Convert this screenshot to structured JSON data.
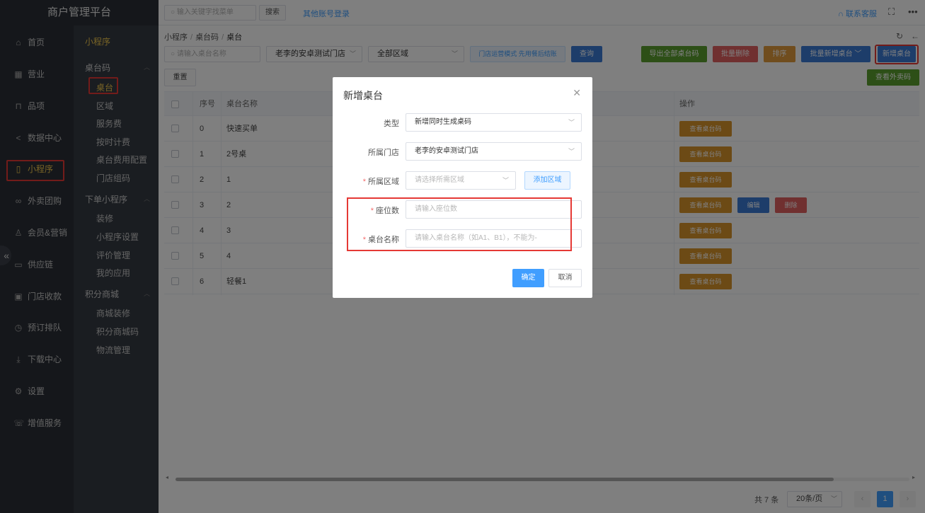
{
  "topbar": {
    "brand": "商户管理平台",
    "search_placeholder": "输入关键字找菜单",
    "search_button": "搜索",
    "other_login": "其他账号登录",
    "contact": "联系客服"
  },
  "sidebar": {
    "items": [
      {
        "icon": "home-icon",
        "label": "首页"
      },
      {
        "icon": "calendar-icon",
        "label": "营业"
      },
      {
        "icon": "bag-icon",
        "label": "品项"
      },
      {
        "icon": "share-icon",
        "label": "数据中心"
      },
      {
        "icon": "phone-icon",
        "label": "小程序"
      },
      {
        "icon": "bike-icon",
        "label": "外卖团购"
      },
      {
        "icon": "user-icon",
        "label": "会员&营销"
      },
      {
        "icon": "truck-icon",
        "label": "供应链"
      },
      {
        "icon": "wallet-icon",
        "label": "门店收款"
      },
      {
        "icon": "clock-icon",
        "label": "预订排队"
      },
      {
        "icon": "download-icon",
        "label": "下载中心"
      },
      {
        "icon": "gear-icon",
        "label": "设置"
      },
      {
        "icon": "service-icon",
        "label": "增值服务"
      }
    ],
    "active": "小程序"
  },
  "submenu": {
    "header": "小程序",
    "groups": [
      {
        "title": "桌台码",
        "items": [
          "桌台",
          "区域",
          "服务费",
          "按时计费",
          "桌台费用配置",
          "门店组码"
        ]
      },
      {
        "title": "下单小程序",
        "items": [
          "装修",
          "小程序设置",
          "评价管理",
          "我的应用"
        ]
      },
      {
        "title": "积分商城",
        "items": [
          "商城装修",
          "积分商城码",
          "物流管理"
        ]
      }
    ],
    "active": "桌台"
  },
  "breadcrumb": [
    "小程序",
    "桌台码",
    "桌台"
  ],
  "filters": {
    "name_placeholder": "请输入桌台名称",
    "store": "老李的安卓测试门店",
    "area": "全部区域",
    "mode_tag": "门店运营模式 先用餐后结账",
    "query": "查询",
    "reset": "重置"
  },
  "actions": {
    "export_all": "导出全部桌台码",
    "batch_delete": "批量删除",
    "sort": "排序",
    "batch_add": "批量新增桌台",
    "add_table": "新增桌台",
    "view_takeout": "查看外卖码"
  },
  "table": {
    "headers": [
      "序号",
      "桌台名称",
      "操作"
    ],
    "rows": [
      {
        "no": "0",
        "name": "快速买单"
      },
      {
        "no": "1",
        "name": "2号桌"
      },
      {
        "no": "2",
        "name": "1"
      },
      {
        "no": "3",
        "name": "2"
      },
      {
        "no": "4",
        "name": "3"
      },
      {
        "no": "5",
        "name": "4"
      },
      {
        "no": "6",
        "name": "轻餐1"
      }
    ],
    "view_code": "查看桌台码",
    "edit": "编辑",
    "delete": "删除"
  },
  "pagination": {
    "total": "共 7 条",
    "page_size": "20条/页",
    "current": "1"
  },
  "dialog": {
    "title": "新增桌台",
    "type_label": "类型",
    "type_value": "新增同时生成桌码",
    "store_label": "所属门店",
    "store_value": "老李的安卓测试门店",
    "area_label": "所属区域",
    "area_placeholder": "请选择所需区域",
    "add_area": "添加区域",
    "seats_label": "座位数",
    "seats_placeholder": "请输入座位数",
    "name_label": "桌台名称",
    "name_placeholder": "请输入桌台名称（如A1、B1），不能为-",
    "confirm": "确定",
    "cancel": "取消"
  },
  "colors": {
    "sidebar_bg": "#2b2f36",
    "submenu_bg": "#353a42",
    "active": "#f2c94c",
    "primary": "#409eff",
    "highlight_box": "#e53935"
  }
}
